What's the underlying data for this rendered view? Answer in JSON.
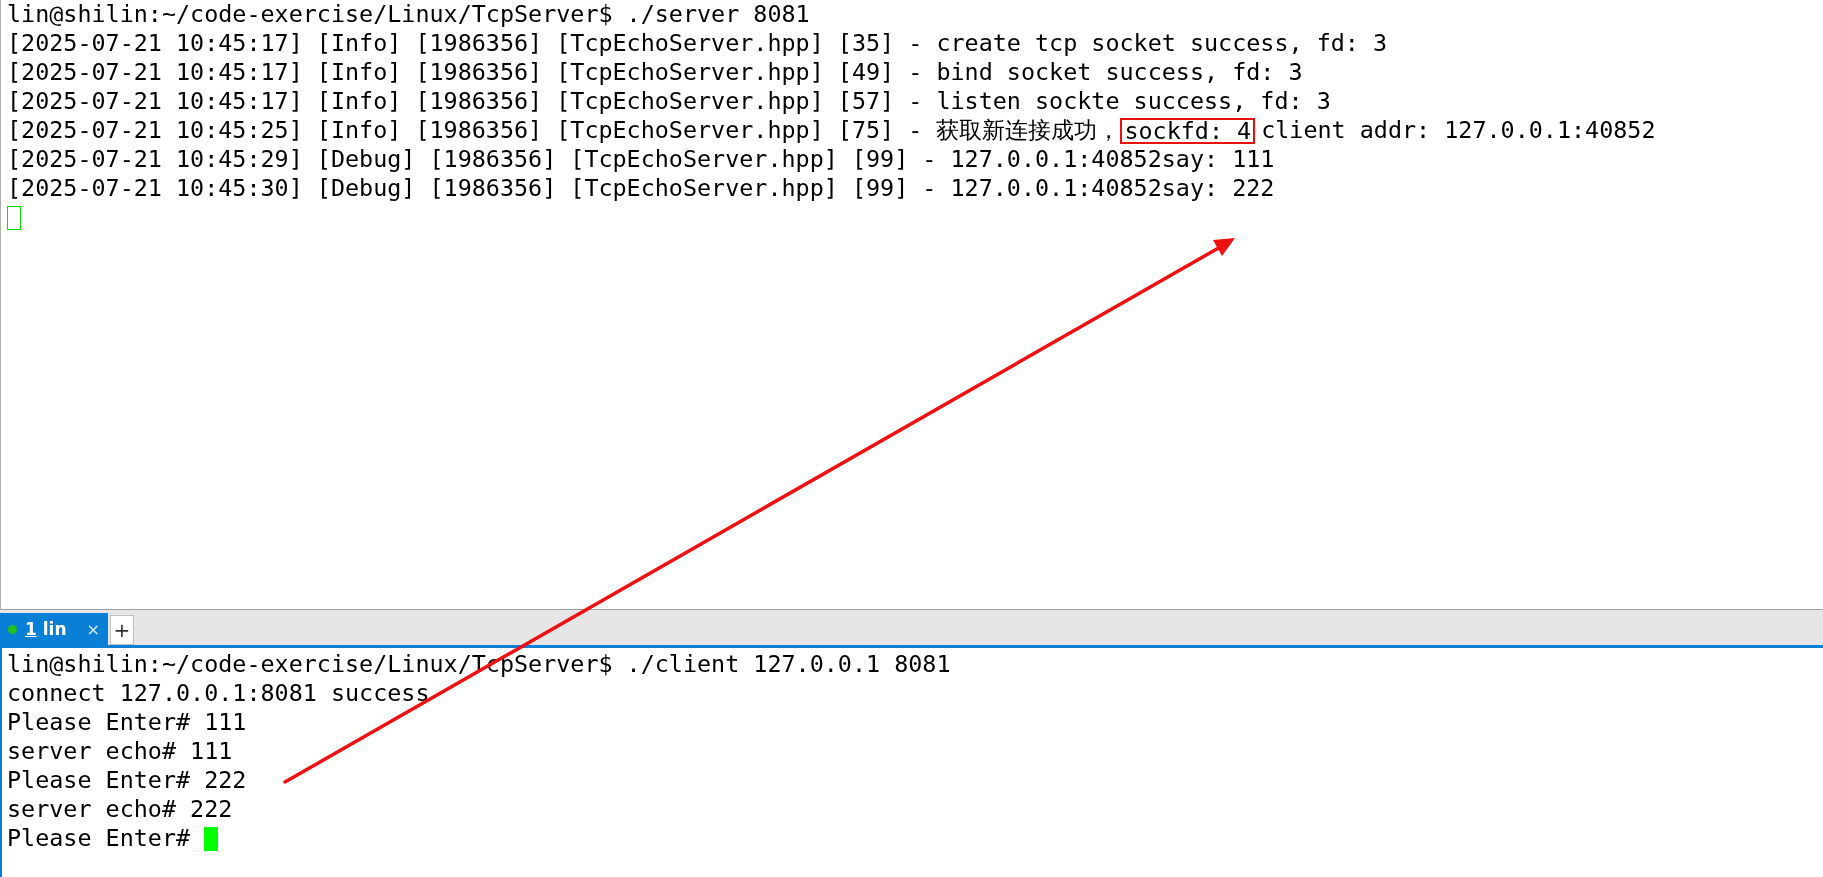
{
  "server_pane": {
    "lines": [
      {
        "segments": [
          {
            "text": "lin@shilin:~/code-exercise/Linux/TcpServer$ ./server 8081",
            "boxed": false
          }
        ]
      },
      {
        "segments": [
          {
            "text": "[2025-07-21 10:45:17] [Info] [1986356] [TcpEchoServer.hpp] [35] - create tcp socket success, fd: 3",
            "boxed": false
          }
        ]
      },
      {
        "segments": [
          {
            "text": "[2025-07-21 10:45:17] [Info] [1986356] [TcpEchoServer.hpp] [49] - bind socket success, fd: 3",
            "boxed": false
          }
        ]
      },
      {
        "segments": [
          {
            "text": "[2025-07-21 10:45:17] [Info] [1986356] [TcpEchoServer.hpp] [57] - listen sockte success, fd: 3",
            "boxed": false
          }
        ]
      },
      {
        "segments": [
          {
            "text": "[2025-07-21 10:45:25] [Info] [1986356] [TcpEchoServer.hpp] [75] - 获取新连接成功，",
            "boxed": false
          },
          {
            "text": "sockfd: 4",
            "boxed": true
          },
          {
            "text": "client addr: 127.0.0.1:40852",
            "boxed": false
          }
        ]
      },
      {
        "segments": [
          {
            "text": "[2025-07-21 10:45:29] [Debug] [1986356] [TcpEchoServer.hpp] [99] - 127.0.0.1:40852say: 111",
            "boxed": false
          }
        ]
      },
      {
        "segments": [
          {
            "text": "[2025-07-21 10:45:30] [Debug] [1986356] [TcpEchoServer.hpp] [99] - 127.0.0.1:40852say: 222",
            "boxed": false
          }
        ]
      }
    ],
    "cursor_focused": false
  },
  "tabs": [
    {
      "number": "1",
      "label": "lin",
      "selected": true,
      "close": "×"
    }
  ],
  "new_tab": "+",
  "client_pane": {
    "lines": [
      {
        "segments": [
          {
            "text": "lin@shilin:~/code-exercise/Linux/TcpServer$ ./client 127.0.0.1 8081",
            "boxed": false
          }
        ]
      },
      {
        "segments": [
          {
            "text": "connect 127.0.0.1:8081 success",
            "boxed": false
          }
        ]
      },
      {
        "segments": [
          {
            "text": "Please Enter# 111",
            "boxed": false
          }
        ]
      },
      {
        "segments": [
          {
            "text": "server echo# 111",
            "boxed": false
          }
        ]
      },
      {
        "segments": [
          {
            "text": "Please Enter# 222",
            "boxed": false
          }
        ]
      },
      {
        "segments": [
          {
            "text": "server echo# 222",
            "boxed": false
          }
        ]
      },
      {
        "segments": [
          {
            "text": "Please Enter#",
            "boxed": false
          }
        ]
      }
    ],
    "cursor_focused": true
  }
}
